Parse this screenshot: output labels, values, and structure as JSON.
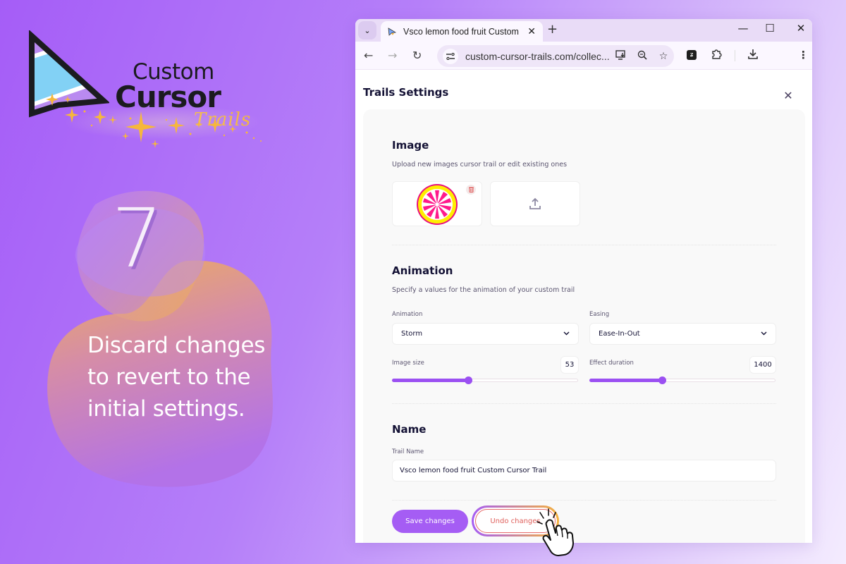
{
  "promo": {
    "logo": {
      "line1": "Custom",
      "line2": "Cursor",
      "line3": "Trails"
    },
    "step_number": "7",
    "message": "Discard changes to revert to the initial settings."
  },
  "browser": {
    "tab": {
      "title": "Vsco lemon food fruit Custom Cursor Trail",
      "favicon": "cursor-favicon"
    },
    "new_tab_label": "+",
    "window_controls": [
      "minimize",
      "maximize",
      "close"
    ],
    "address_bar": {
      "url": "custom-cursor-trails.com/collec..."
    },
    "toolbar_icons": [
      "install-app-icon",
      "zoom-icon",
      "bookmark-star-icon",
      "extension-icon",
      "puzzle-icon",
      "download-icon",
      "menu-icon"
    ]
  },
  "dialog": {
    "title": "Trails Settings",
    "image_section": {
      "title": "Image",
      "subtitle": "Upload new images cursor trail or edit existing ones",
      "images": [
        {
          "name": "lemon-slice",
          "colors": {
            "outer": "#e8117f",
            "rind": "#ffee00",
            "flesh": "#ff1a8c"
          }
        }
      ],
      "upload_label": "upload"
    },
    "animation_section": {
      "title": "Animation",
      "subtitle": "Specify a values for the animation of your custom trail",
      "animation_label": "Animation",
      "animation_value": "Storm",
      "easing_label": "Easing",
      "easing_value": "Ease-In-Out",
      "image_size_label": "Image size",
      "image_size_value": "53",
      "image_size_fraction": 0.41,
      "effect_duration_label": "Effect duration",
      "effect_duration_value": "1400",
      "effect_duration_fraction": 0.39
    },
    "name_section": {
      "title": "Name",
      "field_label": "Trail Name",
      "field_value": "Vsco lemon food fruit Custom Cursor Trail"
    },
    "buttons": {
      "save": "Save changes",
      "undo": "Undo changes"
    }
  },
  "colors": {
    "accent": "#a55df4",
    "undo": "#e0615d",
    "heading": "#141235",
    "gold": "#f3b43d"
  }
}
